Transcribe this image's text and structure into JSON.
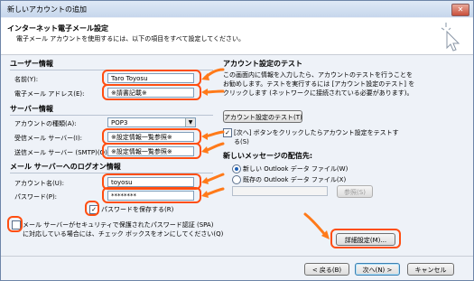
{
  "window": {
    "title": "新しいアカウントの追加",
    "close_glyph": "✕"
  },
  "header": {
    "title": "インターネット電子メール設定",
    "subtitle": "電子メール アカウントを使用するには、以下の項目をすべて設定してください。"
  },
  "user_info": {
    "heading": "ユーザー情報",
    "name_label": "名前(Y):",
    "name_value": "Taro Toyosu",
    "email_label": "電子メール アドレス(E):",
    "email_value": "※請書記載※"
  },
  "server_info": {
    "heading": "サーバー情報",
    "account_type_label": "アカウントの種類(A):",
    "account_type_value": "POP3",
    "incoming_label": "受信メール サーバー(I):",
    "incoming_value": "※設定情報一覧参照※",
    "outgoing_label": "送信メール サーバー (SMTP)(O):",
    "outgoing_value": "※設定情報一覧参照※"
  },
  "logon_info": {
    "heading": "メール サーバーへのログオン情報",
    "account_name_label": "アカウント名(U):",
    "account_name_value": "toyosu",
    "password_label": "パスワード(P):",
    "password_value": "********",
    "remember_password_label": "パスワードを保存する(R)",
    "remember_password_checked": true,
    "spa_label_line1": "メール サーバーがセキュリティで保護されたパスワード認証 (SPA)",
    "spa_label_line2": "に対応している場合には、チェック ボックスをオンにしてください(Q)",
    "spa_checked": false
  },
  "test_settings": {
    "heading": "アカウント設定のテスト",
    "desc_line1": "この画面内に情報を入力したら、アカウントのテストを行うことを",
    "desc_line2": "お勧めします。テストを実行するには [アカウント設定のテスト] を",
    "desc_line3": "クリックします (ネットワークに接続されている必要があります)。",
    "test_button": "アカウント設定のテスト(T)",
    "next_check_label_line1": "[次へ] ボタンをクリックしたらアカウント設定をテストす",
    "next_check_label_line2": "る(S)",
    "next_check_checked": true
  },
  "delivery": {
    "heading": "新しいメッセージの配信先:",
    "option_new": "新しい Outlook データ ファイル(W)",
    "option_existing": "既存の Outlook データ ファイル(X)",
    "selected": "new",
    "browse_button": "参照(S)"
  },
  "buttons": {
    "more_settings": "詳細設定(M)...",
    "back": "< 戻る(B)",
    "next": "次へ(N) >",
    "cancel": "キャンセル"
  },
  "colors": {
    "highlight_ring": "#ff4e11",
    "highlight_arrow": "#ff7a1a"
  }
}
